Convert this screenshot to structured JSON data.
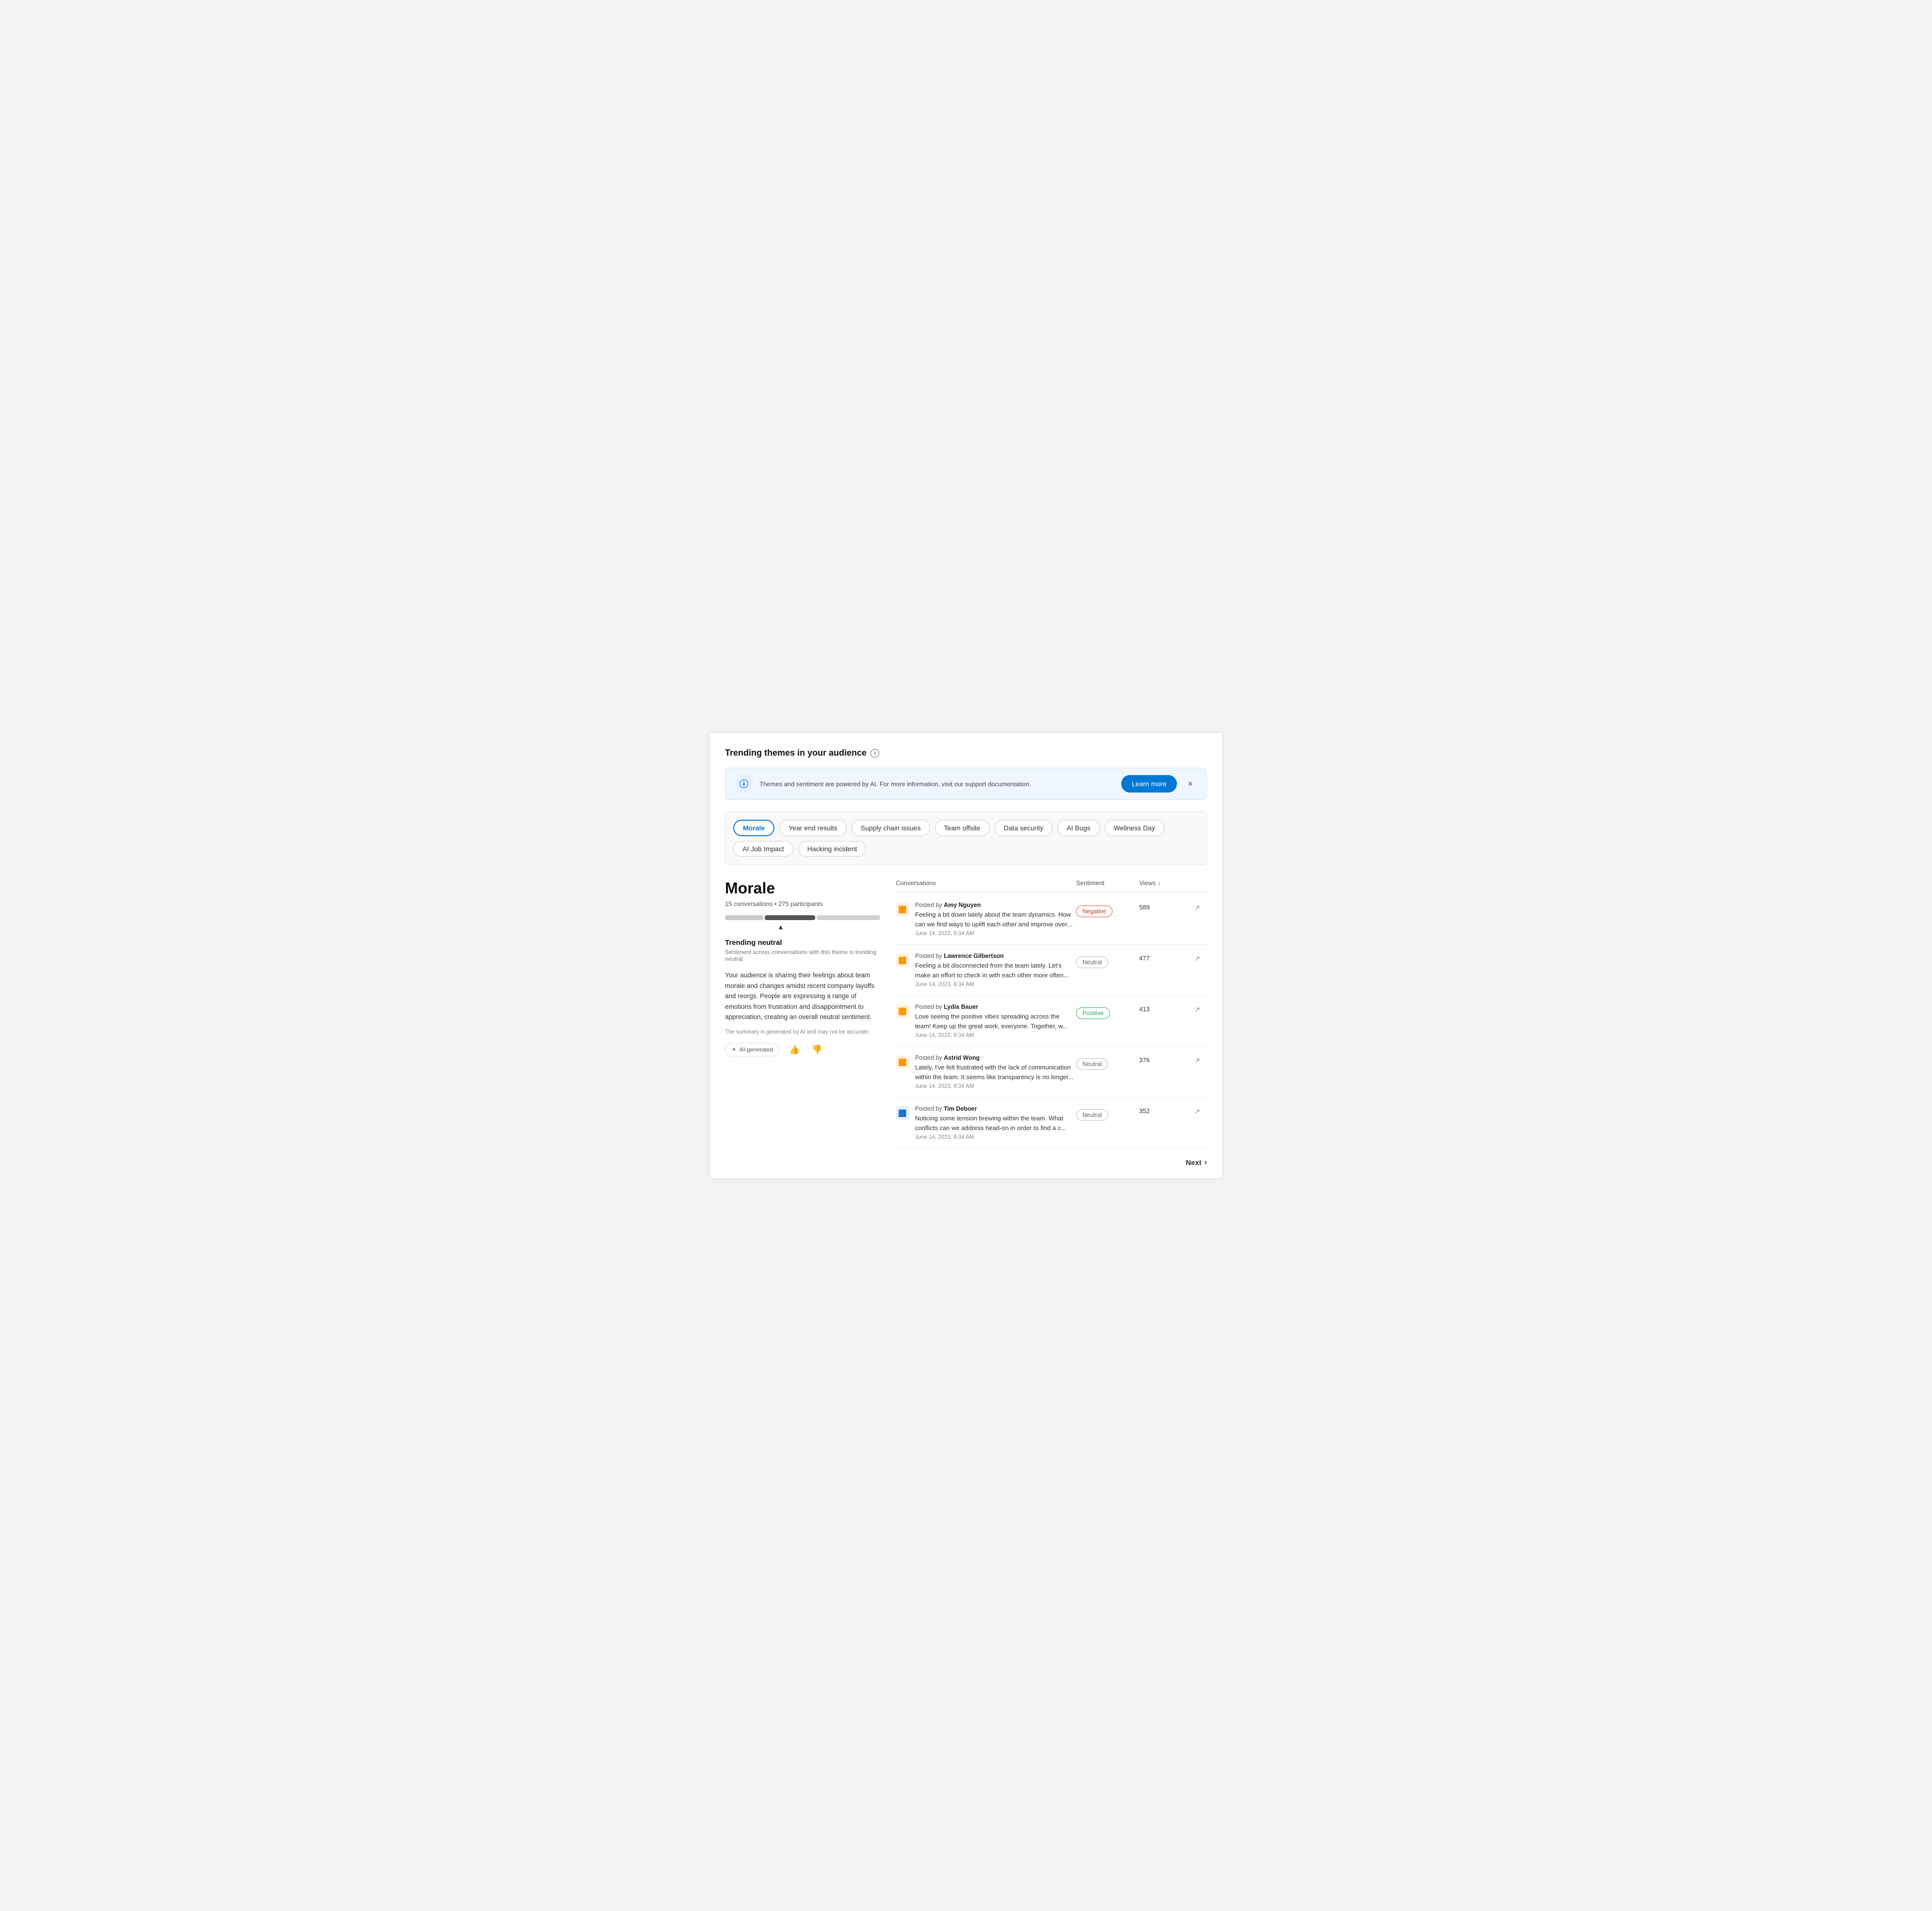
{
  "page": {
    "title": "Trending themes in your audience"
  },
  "banner": {
    "text": "Themes and sentiment are powered by AI. For more information, visit our support documentation.",
    "learn_more_label": "Learn more",
    "close_label": "×"
  },
  "themes": {
    "items": [
      {
        "id": "morale",
        "label": "Morale",
        "active": true
      },
      {
        "id": "year-end",
        "label": "Year end results",
        "active": false
      },
      {
        "id": "supply-chain",
        "label": "Supply chain issues",
        "active": false
      },
      {
        "id": "team-offsite",
        "label": "Team offsite",
        "active": false
      },
      {
        "id": "data-security",
        "label": "Data security",
        "active": false
      },
      {
        "id": "ai-bugs",
        "label": "AI Bugs",
        "active": false
      },
      {
        "id": "wellness-day",
        "label": "Wellness Day",
        "active": false
      },
      {
        "id": "ai-job-impact",
        "label": "AI Job Impact",
        "active": false
      },
      {
        "id": "hacking-incident",
        "label": "Hacking incident",
        "active": false
      }
    ]
  },
  "left_panel": {
    "theme_name": "Morale",
    "conversations_count": "15 conversations",
    "participants_count": "275 participants",
    "trending_label": "Trending neutral",
    "trending_subtitle": "Sentiment across conversations with this theme is trending neutral",
    "description": "Your audience is sharing their feelings about team morale and changes amidst recent company layoffs and reorgs. People are expressing a range of emotions from frustration and disappointment to appreciation, creating an overall neutral sentiment.",
    "ai_disclaimer": "The summary is generated by AI and may not be accurate.",
    "ai_generated_label": "AI-generated",
    "thumbs_up_label": "👍",
    "thumbs_down_label": "👎"
  },
  "table": {
    "col_conversations": "Conversations",
    "col_sentiment": "Sentiment",
    "col_views": "Views",
    "rows": [
      {
        "author": "Amy Nguyen",
        "text": "Feeling a bit down lately about the team dynamics. How can we find ways to uplift each other and improve over...",
        "date": "June 14, 2023, 9:34 AM",
        "sentiment": "Negative",
        "sentiment_type": "negative",
        "views": "589",
        "icon_type": "orange"
      },
      {
        "author": "Lawrence Gilbertson",
        "text": "Feeling a bit disconnected from the team lately. Let's make an effort to check in with each other more often...",
        "date": "June 14, 2023, 9:34 AM",
        "sentiment": "Neutral",
        "sentiment_type": "neutral",
        "views": "477",
        "icon_type": "orange"
      },
      {
        "author": "Lydia Bauer",
        "text": "Love seeing the positive vibes spreading across the team! Keep up the great work, everyone. Together, w...",
        "date": "June 14, 2023, 9:34 AM",
        "sentiment": "Positive",
        "sentiment_type": "positive",
        "views": "413",
        "icon_type": "orange"
      },
      {
        "author": "Astrid Wong",
        "text": "Lately, I've felt frustrated with the lack of communication within the team. It seems like transparency is no longer...",
        "date": "June 14, 2023, 9:34 AM",
        "sentiment": "Neutral",
        "sentiment_type": "neutral",
        "views": "376",
        "icon_type": "orange"
      },
      {
        "author": "Tim Deboer",
        "text": "Noticing some tension brewing within the team. What conflicts can we address head-on in order to find a c...",
        "date": "June 14, 2023, 9:34 AM",
        "sentiment": "Neutral",
        "sentiment_type": "neutral",
        "views": "352",
        "icon_type": "blue"
      }
    ]
  },
  "pagination": {
    "next_label": "Next"
  }
}
